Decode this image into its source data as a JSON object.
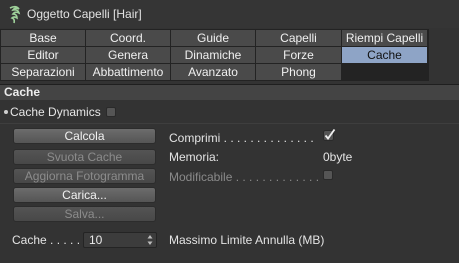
{
  "window": {
    "title": "Oggetto Capelli [Hair]"
  },
  "tabs": [
    {
      "label": "Base"
    },
    {
      "label": "Coord."
    },
    {
      "label": "Guide"
    },
    {
      "label": "Capelli"
    },
    {
      "label": "Riempi Capelli"
    },
    {
      "label": "Editor"
    },
    {
      "label": "Genera"
    },
    {
      "label": "Dinamiche"
    },
    {
      "label": "Forze"
    },
    {
      "label": "Cache"
    },
    {
      "label": "Separazioni"
    },
    {
      "label": "Abbattimento"
    },
    {
      "label": "Avanzato"
    },
    {
      "label": "Phong"
    }
  ],
  "active_tab": "Cache",
  "section": {
    "title": "Cache"
  },
  "cache_dynamics": {
    "label": "Cache Dynamics",
    "checked": false
  },
  "buttons": {
    "calcola": "Calcola",
    "svuota": "Svuota Cache",
    "aggiorna": "Aggiorna Fotogramma",
    "carica": "Carica...",
    "salva": "Salva..."
  },
  "fields": {
    "comprimi_label": "Comprimi . . . . . . . . . . . . . .",
    "comprimi_checked": true,
    "memoria_label": "Memoria:",
    "memoria_value": "0byte",
    "modificabile_label": "Modificabile . . . . . . . . . . . . .",
    "modificabile_checked": false
  },
  "cache_size": {
    "label": "Cache . . . . .",
    "value": "10",
    "unit_text": "Massimo Limite Annulla (MB)"
  },
  "colors": {
    "active_tab": "#8ea4c6",
    "background": "#333333"
  }
}
